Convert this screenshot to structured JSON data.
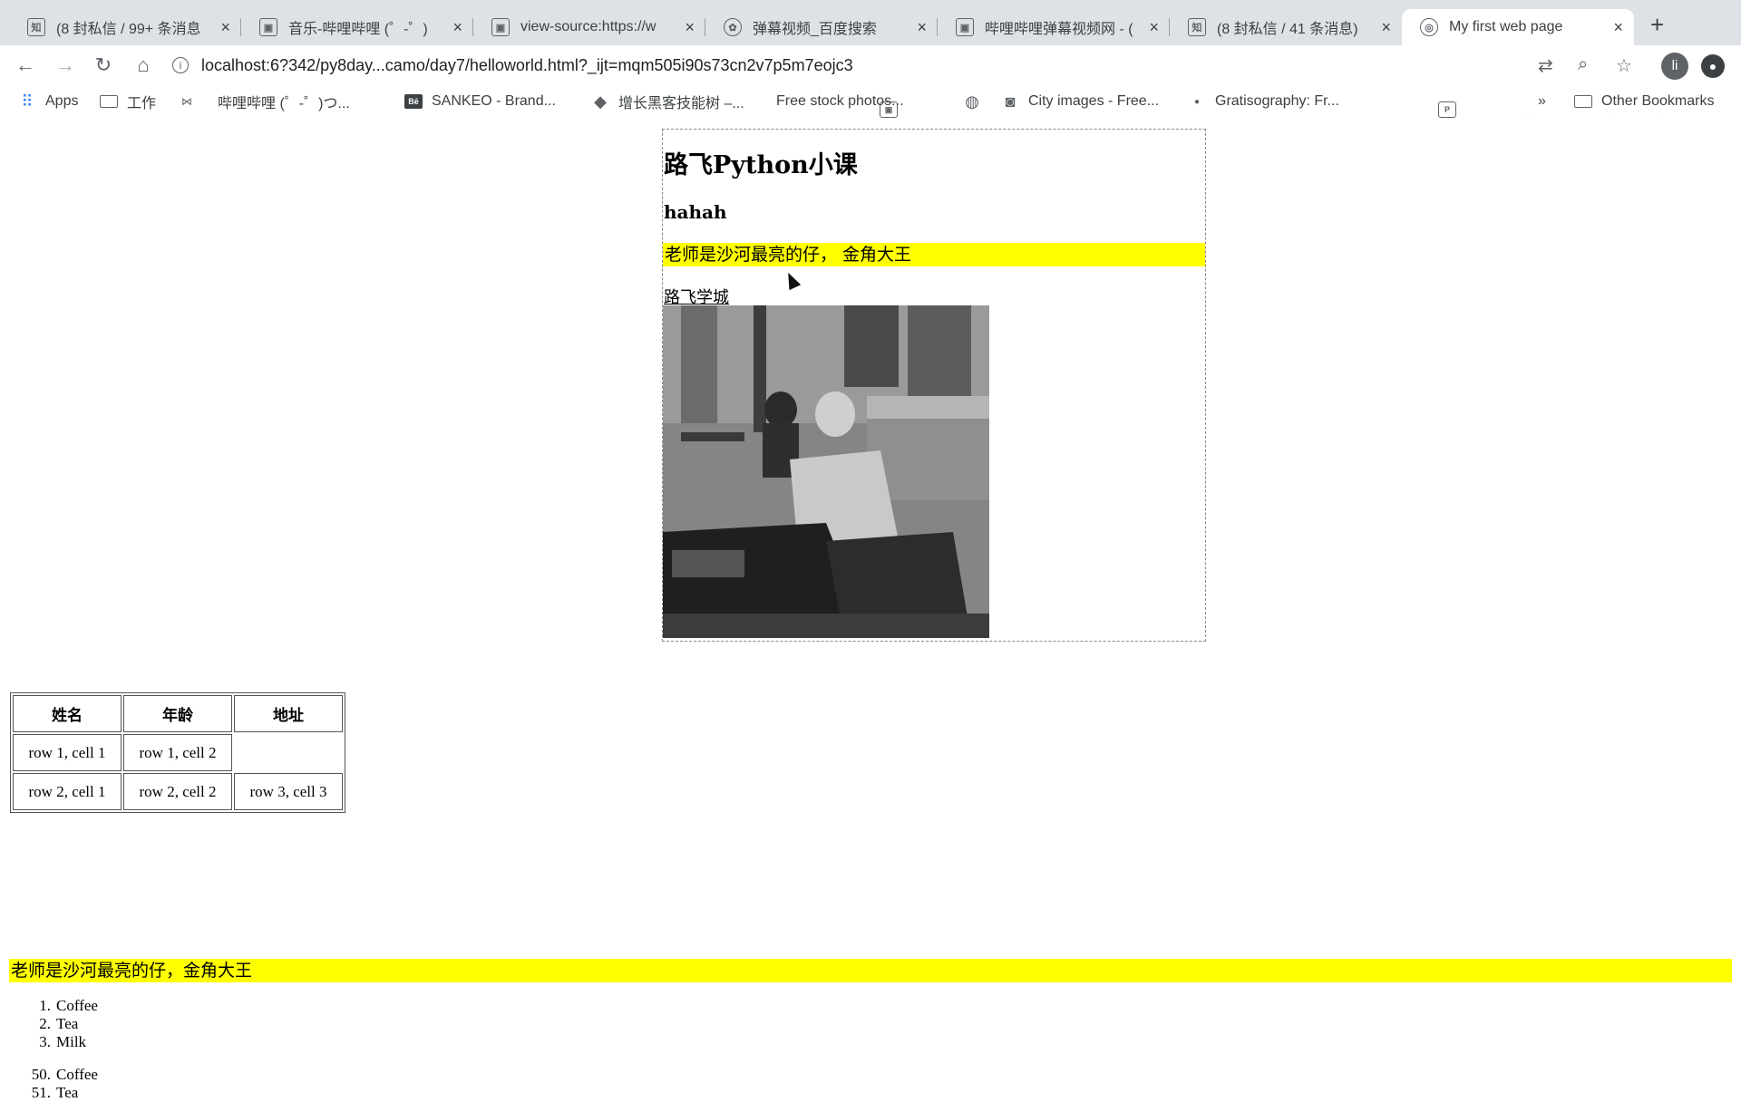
{
  "browser": {
    "tabs": [
      {
        "icon": "zhihu-icon",
        "glyph": "知",
        "title": "(8 封私信 / 99+ 条消息",
        "active": false
      },
      {
        "icon": "bilibili-icon",
        "glyph": "▣",
        "title": "音乐-哔哩哔哩 (゜-゜)",
        "active": false
      },
      {
        "icon": "bilibili-icon",
        "glyph": "▣",
        "title": "view-source:https://w",
        "active": false
      },
      {
        "icon": "baidu-icon",
        "glyph": "✿",
        "title": "弹幕视频_百度搜索",
        "active": false
      },
      {
        "icon": "bilibili-icon",
        "glyph": "▣",
        "title": "哔哩哔哩弹幕视频网 - (",
        "active": false
      },
      {
        "icon": "zhihu-icon",
        "glyph": "知",
        "title": "(8 封私信 / 41 条消息)",
        "active": false
      },
      {
        "icon": "webpage-icon",
        "glyph": "◎",
        "title": "My first web page",
        "active": true
      }
    ],
    "close_glyph": "×",
    "new_tab_glyph": "+",
    "url": "localhost:6?342/py8day...camo/day7/helloworld.html?_ijt=mqm505i90s73cn2v7p5m7eojc3",
    "avatar_letter": "li",
    "watermark": "路飞学城",
    "bookmarks": [
      {
        "icon": "apps-icon",
        "label": "Apps"
      },
      {
        "icon": "folder-icon",
        "label": "工作"
      },
      {
        "icon": "bookmark-logo-icon",
        "label": ""
      },
      {
        "icon": "bilibili-icon",
        "label": "哔哩哔哩 (゜-゜)つ..."
      },
      {
        "icon": "behance-icon",
        "label": "SANKEO - Brand..."
      },
      {
        "icon": "cube-icon",
        "label": "增长黑客技能树 –..."
      },
      {
        "icon": "photo-site-icon",
        "label": "Free stock photos..."
      },
      {
        "icon": "globe-icon",
        "label": ""
      },
      {
        "icon": "camera-icon",
        "label": "City images - Free..."
      },
      {
        "icon": "dot-icon",
        "label": "Gratisography: Fr..."
      }
    ],
    "overflow": "»",
    "other_bookmarks": "Other Bookmarks"
  },
  "page": {
    "h1": "路飞Python小课",
    "h3": "hahah",
    "highlight_1": "老师是沙河最亮的仔， 金角大王",
    "link": "路飞学城",
    "table": {
      "headers": [
        "姓名",
        "年龄",
        "地址"
      ],
      "rows": [
        [
          "row 1, cell 1",
          "row 1, cell 2",
          ""
        ],
        [
          "row 2, cell 1",
          "row 2, cell 2",
          "row 3, cell 3"
        ]
      ]
    },
    "highlight_2": "老师是沙河最亮的仔，金角大王",
    "list_1": [
      {
        "num": "1.",
        "text": "Coffee"
      },
      {
        "num": "2.",
        "text": "Tea"
      },
      {
        "num": "3.",
        "text": "Milk"
      }
    ],
    "list_2": [
      {
        "num": "50.",
        "text": "Coffee"
      },
      {
        "num": "51.",
        "text": "Tea"
      }
    ]
  },
  "colors": {
    "highlight": "#ffff00",
    "tabbar": "#dee1e6"
  }
}
